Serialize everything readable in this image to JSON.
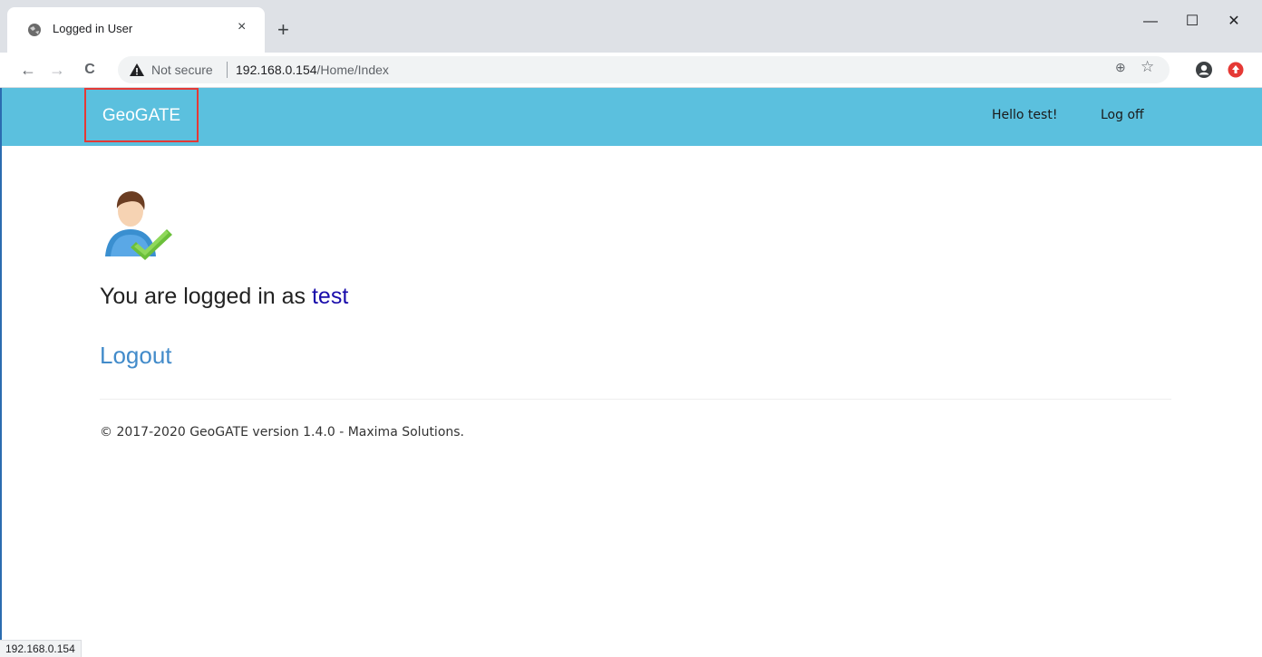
{
  "browser": {
    "tab_title": "Logged in User",
    "tab_close": "×",
    "new_tab": "+",
    "window_controls": {
      "minimize": "—",
      "maximize": "☐",
      "close": "✕"
    },
    "nav": {
      "back": "←",
      "forward": "→",
      "reload": "C"
    },
    "security_label": "Not secure",
    "url_host": "192.168.0.154",
    "url_path": "/Home/Index",
    "zoom_icon": "⊕",
    "star_icon": "☆",
    "status_text": "192.168.0.154"
  },
  "navbar": {
    "brand": "GeoGATE",
    "greeting": "Hello test!",
    "logoff": "Log off",
    "color": "#5bc0de"
  },
  "main": {
    "logged_in_prefix": "You are logged in as ",
    "username": "test",
    "logout": "Logout",
    "footer": "© 2017-2020 GeoGATE version 1.4.0 - Maxima Solutions."
  }
}
